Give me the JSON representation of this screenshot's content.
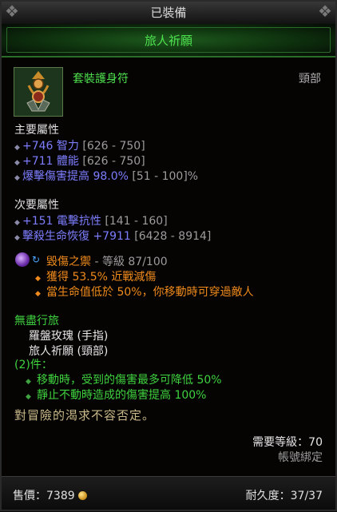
{
  "header": {
    "equipped_label": "已裝備",
    "item_name": "旅人祈願"
  },
  "item": {
    "icon": "amulet-icon",
    "type": "套裝護身符",
    "slot": "頸部"
  },
  "primary": {
    "title": "主要屬性",
    "stats": [
      {
        "value": "+746 智力",
        "range": " [626 - 750]"
      },
      {
        "value": "+711 體能",
        "range": " [626 - 750]"
      },
      {
        "value": "爆擊傷害提高 98.0%",
        "range": " [51 - 100]%"
      }
    ]
  },
  "secondary": {
    "title": "次要屬性",
    "stats": [
      {
        "value": "+151 電擊抗性",
        "range": " [141 - 160]"
      },
      {
        "value": "擊殺生命恢復 +7911",
        "range": " [6428 - 8914]"
      }
    ]
  },
  "gem": {
    "name": "毀傷之禦",
    "rank": " - 等級 87/100",
    "effects": [
      "獲得 53.5% 近戰減傷",
      "當生命值低於 50%，你移動時可穿過敵人"
    ]
  },
  "set": {
    "name": "無盡行旅",
    "pieces": [
      "羅盤玫瑰 (手指)",
      "旅人祈願 (頸部)"
    ],
    "bonus_title": "(2)件：",
    "bonuses": [
      "移動時，受到的傷害最多可降低 50%",
      "靜止不動時造成的傷害提高 100%"
    ]
  },
  "flavor": "對冒險的渴求不容否定。",
  "requirements": {
    "level": "需要等級：70",
    "bound": "帳號綁定"
  },
  "footer": {
    "price_label": "售價：7389",
    "durability_label": "耐久度：37/37"
  },
  "colors": {
    "magic_blue": "#7d7dff",
    "set_green": "#4ee14e",
    "legendary_orange": "#f08a1c"
  }
}
